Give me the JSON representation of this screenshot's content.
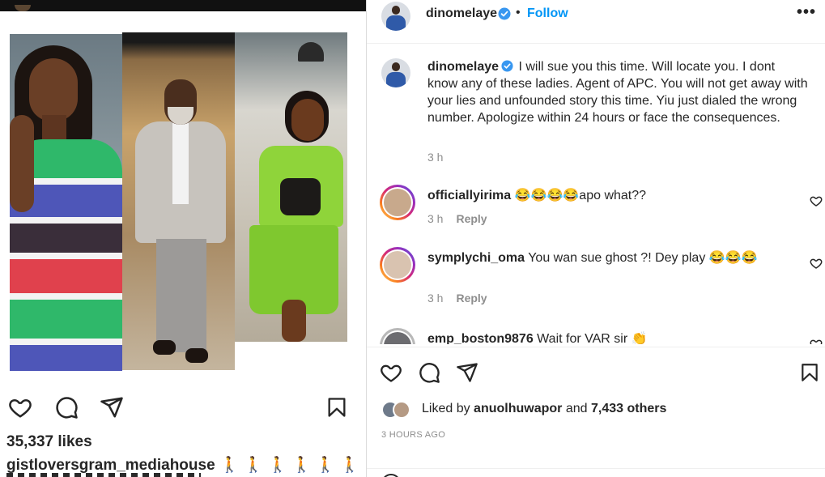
{
  "left_post": {
    "likes": "35,337 likes",
    "caption_username": "gistloversgram_mediahouse",
    "caption_emoji": "🚶🚶🚶🚶🚶🚶🚶",
    "icons": [
      "heart-icon",
      "comment-icon",
      "share-icon",
      "bookmark-icon"
    ]
  },
  "header": {
    "username": "dinomelaye",
    "dot": "•",
    "follow_label": "Follow",
    "more_label": "•••"
  },
  "caption": {
    "username": "dinomelaye",
    "text": "I will sue you this time. Will locate you. I dont know any of these ladies. Agent of APC. You will not get away with your lies and unfounded story this time. Yiu just dialed the wrong number. Apologize within 24 hours or face the consequences.",
    "time": "3 h"
  },
  "comments": [
    {
      "username": "officiallyirima",
      "text": "😂😂😂😂apo what??",
      "time": "3 h",
      "reply_label": "Reply"
    },
    {
      "username": "symplychi_oma",
      "text": "You wan sue ghost ?! Dey play 😂😂😂",
      "time": "3 h",
      "reply_label": "Reply"
    },
    {
      "username": "emp_boston9876",
      "text": "Wait for VAR sir 👏"
    }
  ],
  "actions": {
    "liked_by_prefix": "Liked by",
    "liked_by_user": "anuolhuwapor",
    "liked_by_and": "and",
    "liked_by_others": "7,433 others",
    "post_time": "3 HOURS AGO"
  },
  "colors": {
    "accent": "#0095f6",
    "text_primary": "#262626",
    "text_secondary": "#8e8e8e",
    "divider": "#dbdbdb"
  }
}
